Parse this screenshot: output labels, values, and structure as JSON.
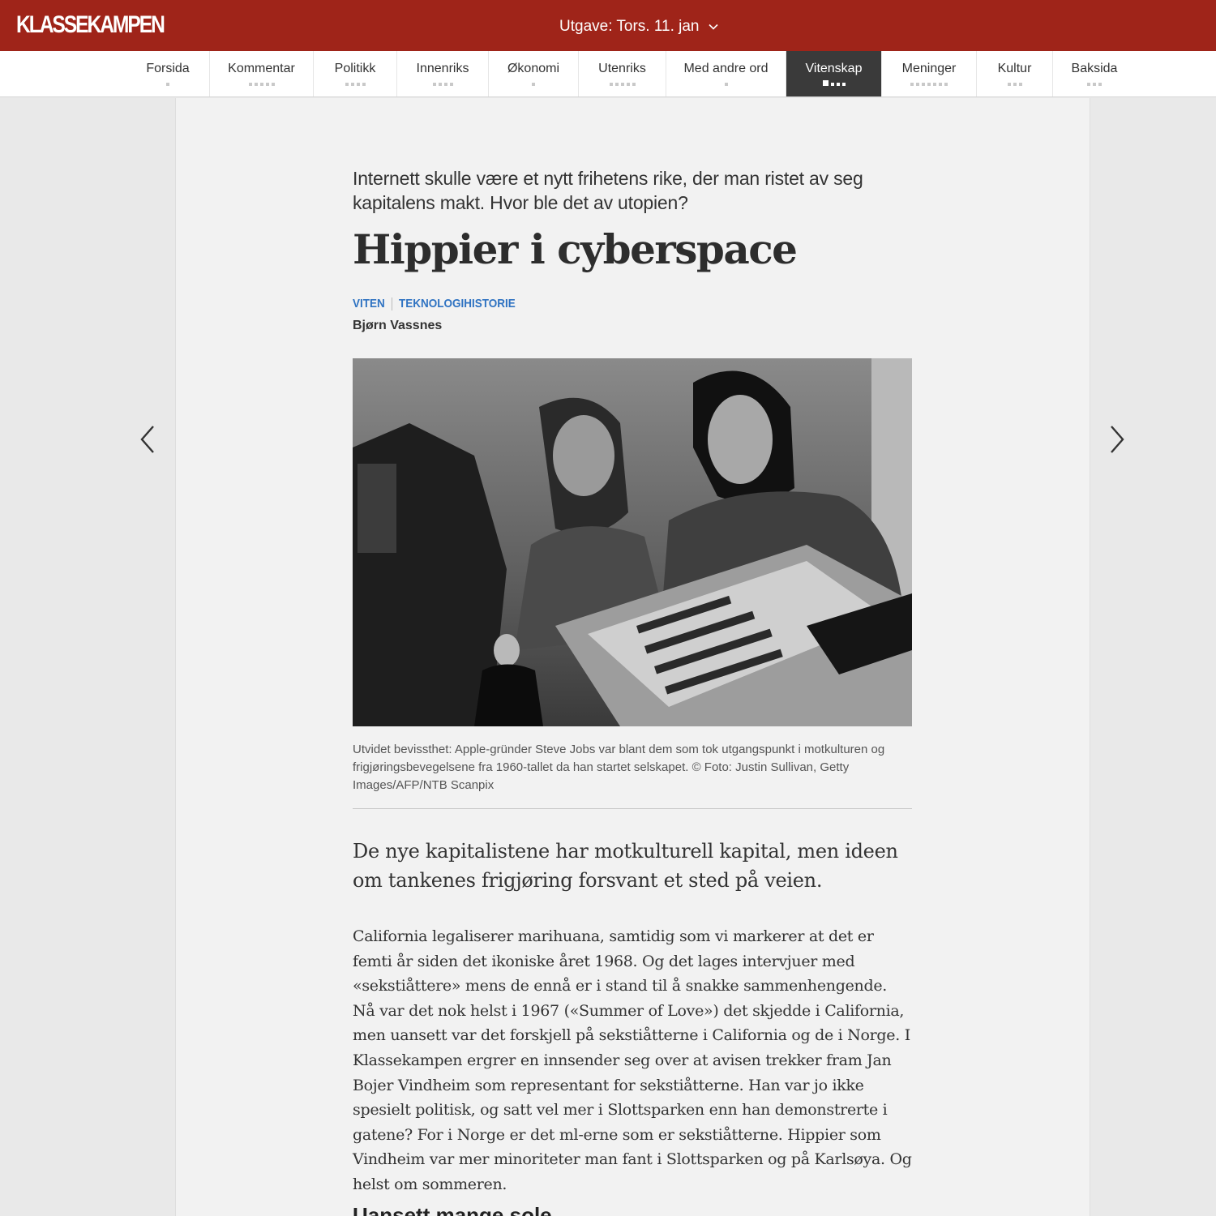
{
  "header": {
    "logo": "KLASSEKAMPEN",
    "edition_label": "Utgave: Tors. 11. jan"
  },
  "nav": {
    "items": [
      {
        "label": "Forsida",
        "dots": 1,
        "active": false
      },
      {
        "label": "Kommentar",
        "dots": 5,
        "active": false
      },
      {
        "label": "Politikk",
        "dots": 4,
        "active": false
      },
      {
        "label": "Innenriks",
        "dots": 4,
        "active": false
      },
      {
        "label": "Økonomi",
        "dots": 1,
        "active": false
      },
      {
        "label": "Utenriks",
        "dots": 5,
        "active": false
      },
      {
        "label": "Med andre ord",
        "dots": 1,
        "active": false
      },
      {
        "label": "Vitenskap",
        "dots": 4,
        "active": true,
        "current_dot": 1
      },
      {
        "label": "Meninger",
        "dots": 7,
        "active": false
      },
      {
        "label": "Kultur",
        "dots": 3,
        "active": false
      },
      {
        "label": "Baksida",
        "dots": 3,
        "active": false
      }
    ]
  },
  "article": {
    "kicker": "Internett skulle være et nytt frihetens rike, der man ristet av seg kapitalens makt. Hvor ble det av utopien?",
    "title": "Hippier i cyberspace",
    "tags": [
      "VITEN",
      "TEKNOLOGIHISTORIE"
    ],
    "author": "Bjørn Vassnes",
    "photo_icon": "photo-steve-jobs-apple-i",
    "caption": "Utvidet bevissthet: Apple-gründer Steve Jobs var blant dem som tok utgangspunkt i motkulturen og frigjøringsbevegelsene fra 1960-tallet da han startet selskapet. © Foto: Justin Sullivan, Getty Images/AFP/NTB Scanpix",
    "ingress": "De nye kapitalistene har motkulturell kapital, men ideen om tankenes frigjøring forsvant et sted på veien.",
    "body": "California legaliserer marihuana, samtidig som vi markerer at det er femti år siden det ikoniske året 1968. Og det lages intervjuer med «sekstiåttere» mens de ennå er i stand til å snakke sammenhengende. Nå var det nok helst i 1967 («Summer of Love») det skjedde i California, men uansett var det forskjell på sekstiåtterne i California og de i Norge. I Klassekampen ergrer en innsender seg over at avisen trekker fram Jan Bojer Vindheim som representant for sekstiåtterne. Han var jo ikke spesielt politisk, og satt vel mer i Slottsparken enn han demonstrerte i gatene? For i Norge er det ml-erne som er sekstiåtterne. Hippier som Vindheim var mer minoriteter man fant i Slottsparken og på Karlsøya. Og helst om sommeren.",
    "subhead": "Uansett mange sole"
  },
  "colors": {
    "brand_red": "#9f2419",
    "tag_blue": "#2f73c2",
    "nav_active": "#3a3a3a"
  },
  "icons": {
    "edition_toggle": "chevron-down-icon",
    "prev": "chevron-left-icon",
    "next": "chevron-right-icon"
  }
}
